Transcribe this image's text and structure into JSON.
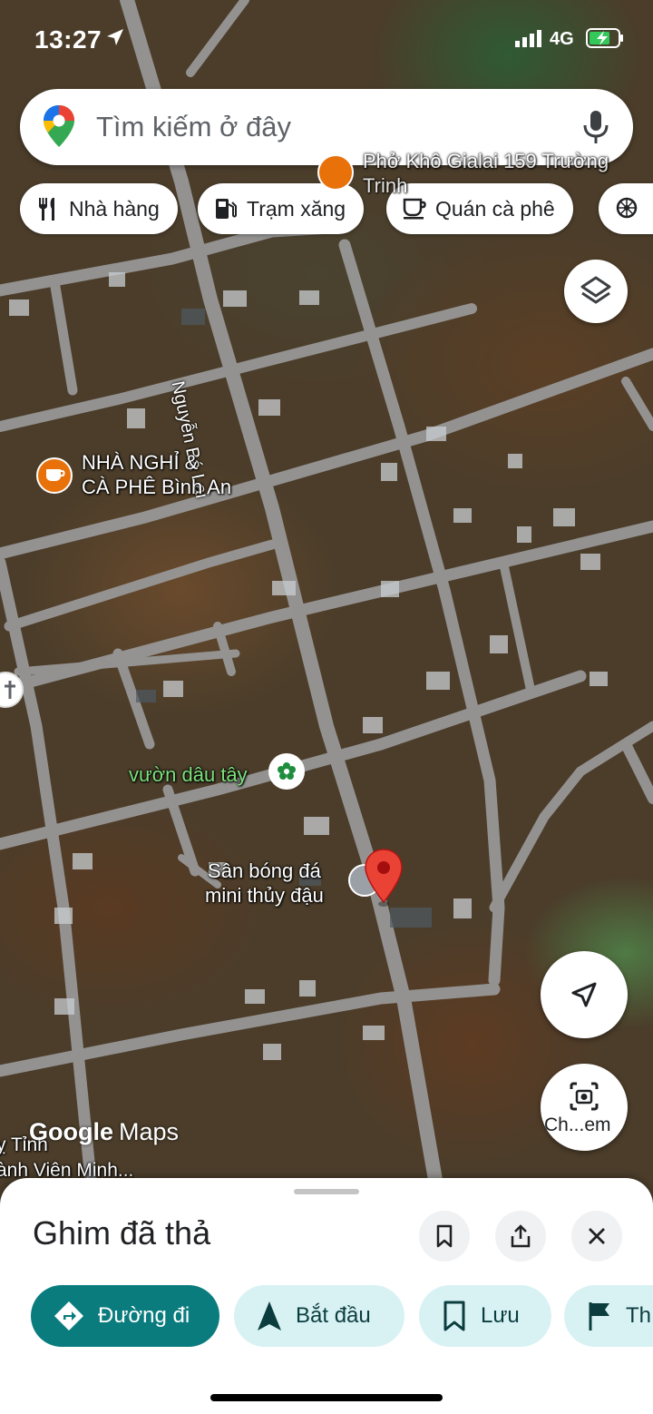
{
  "status_bar": {
    "time": "13:27",
    "network": "4G"
  },
  "search": {
    "placeholder": "Tìm kiếm ở đây"
  },
  "chips": [
    {
      "label": "Nhà hàng",
      "icon": "fork-knife-icon"
    },
    {
      "label": "Trạm xăng",
      "icon": "gas-pump-icon"
    },
    {
      "label": "Quán cà phê",
      "icon": "coffee-cup-icon"
    },
    {
      "label": "",
      "icon": "attraction-icon"
    }
  ],
  "map": {
    "street_name": "Nguyễn Bá Lai",
    "poi_top": "Phở Khô Gialai 159 Trường Trinh",
    "poi_inn_line1": "NHÀ NGHỈ &",
    "poi_inn_line2": "CÀ PHÊ Bình An",
    "poi_garden": "vườn dâu tây",
    "poi_field_line1": "Sân bóng đá",
    "poi_field_line2": "mini thủy đậu",
    "bottom_left_line1": "ỵ Tỉnh",
    "bottom_left_line2": "ành Viên Minh..."
  },
  "logo": {
    "google": "Google",
    "maps": "Maps"
  },
  "buttons": {
    "camera_label": "Ch...em"
  },
  "sheet": {
    "title": "Ghim đã thả",
    "actions": [
      {
        "label": "Đường đi",
        "icon": "directions-icon"
      },
      {
        "label": "Bắt đầu",
        "icon": "navigation-arrow-icon"
      },
      {
        "label": "Lưu",
        "icon": "bookmark-icon"
      },
      {
        "label": "Th",
        "icon": "flag-icon"
      }
    ]
  },
  "colors": {
    "primary_action": "#0b7c7e",
    "secondary_action": "#d8f2f4",
    "pin": "#ea4335"
  }
}
